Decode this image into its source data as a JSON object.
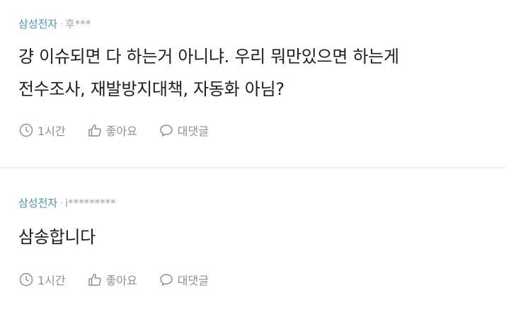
{
  "comments": [
    {
      "company": "삼성전자",
      "separator": "·",
      "user": "후***",
      "lines": [
        "걍 이슈되면 다 하는거 아니냐. 우리 뭐만있으면 하는게",
        "전수조사, 재발방지대책, 자동화 아님?"
      ],
      "time": "1시간",
      "like_label": "좋아요",
      "reply_label": "대댓글"
    },
    {
      "company": "삼성전자",
      "separator": "·",
      "user": "i*********",
      "lines": [
        "삼송합니다"
      ],
      "time": "1시간",
      "like_label": "좋아요",
      "reply_label": "대댓글"
    }
  ],
  "colors": {
    "company": "#4a90c2",
    "meta": "#9a9a9a",
    "text": "#1e1e1e",
    "action": "#8f8f8f",
    "divider": "#f1f1f1"
  },
  "icons": {
    "time": "clock-icon",
    "like": "thumbs-up-icon",
    "reply": "speech-bubble-icon"
  }
}
